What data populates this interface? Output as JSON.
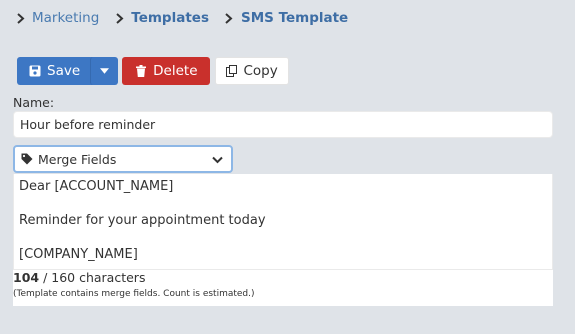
{
  "breadcrumb": {
    "items": [
      {
        "label": "Marketing"
      },
      {
        "label": "Templates"
      },
      {
        "label": "SMS Template"
      }
    ]
  },
  "toolbar": {
    "save_label": "Save",
    "delete_label": "Delete",
    "copy_label": "Copy"
  },
  "form": {
    "name_label": "Name:",
    "name_value": "Hour before reminder",
    "merge_fields_label": "Merge Fields"
  },
  "message": {
    "lines": [
      "Dear [ACCOUNT_NAME]",
      "Reminder for your appointment today",
      "[COMPANY_NAME]"
    ]
  },
  "counter": {
    "count": "104",
    "suffix": " / 160 characters",
    "note": "(Template contains merge fields. Count is estimated.)"
  },
  "colors": {
    "primary": "#3d77c4",
    "danger": "#c9302c",
    "link": "#4a7bb0",
    "background": "#dfe3e8"
  },
  "icons": [
    "chevron-right-icon",
    "floppy-disk-icon",
    "caret-down-icon",
    "trash-icon",
    "copy-icon",
    "tag-icon",
    "chevron-down-icon"
  ]
}
